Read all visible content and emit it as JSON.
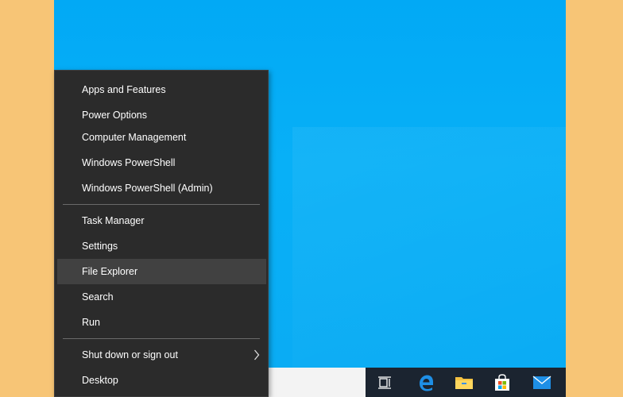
{
  "colors": {
    "page_bg": "#f7c576",
    "desktop_blue": "#08b0f7",
    "menu_bg": "#2b2b2b",
    "menu_highlight": "#414141",
    "taskbar_bg": "#1b2430"
  },
  "menu": {
    "items": [
      {
        "label": "Apps and Features"
      },
      {
        "label": "Power Options"
      },
      {
        "label": "Computer Management"
      },
      {
        "label": "Windows PowerShell"
      },
      {
        "label": "Windows PowerShell (Admin)"
      },
      {
        "label": "Task Manager"
      },
      {
        "label": "Settings"
      },
      {
        "label": "File Explorer",
        "highlighted": true
      },
      {
        "label": "Search"
      },
      {
        "label": "Run"
      },
      {
        "label": "Shut down or sign out",
        "submenu": true
      },
      {
        "label": "Desktop"
      }
    ]
  },
  "taskbar": {
    "icons": [
      "task-view-icon",
      "edge-icon",
      "file-explorer-icon",
      "store-icon",
      "mail-icon"
    ]
  }
}
